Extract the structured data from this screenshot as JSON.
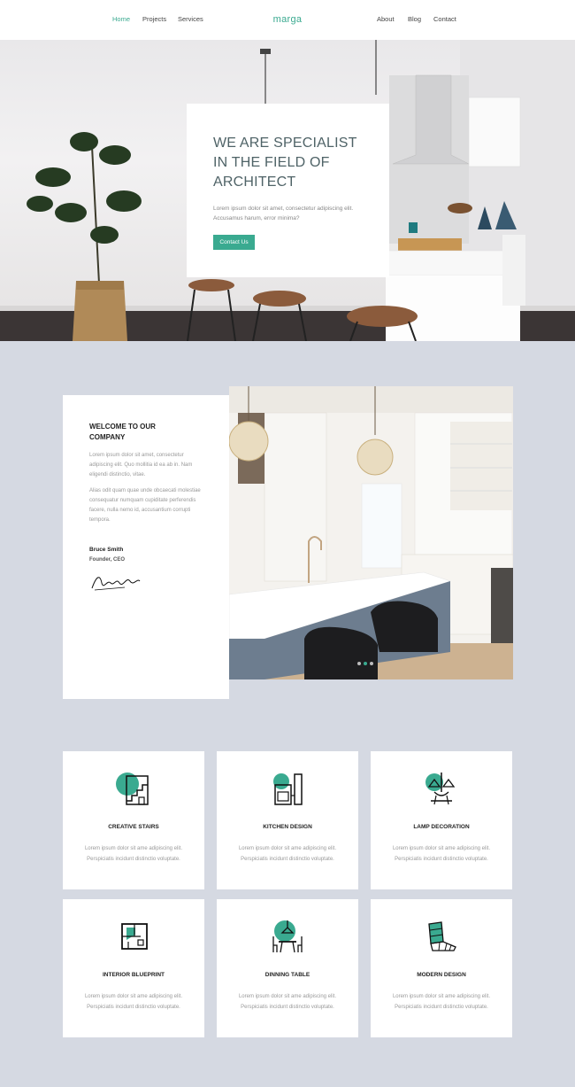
{
  "nav": {
    "left_links": [
      "Home",
      "Projects",
      "Services"
    ],
    "logo": "marga",
    "right_links": [
      "About",
      "Blog",
      "Contact"
    ],
    "active": "Home",
    "accent": "#3aaa90"
  },
  "hero": {
    "title": "WE ARE SPECIALIST IN THE FIELD OF ARCHITECT",
    "text": "Lorem ipsum dolor sit amet, consectetur adipiscing elit. Accusamus harum, error minima?",
    "button": "Contact Us"
  },
  "about": {
    "title": "WELCOME TO OUR COMPANY",
    "paragraph1": "Lorem ipsum dolor sit amet, consectetur adipiscing elit. Quo mollitia id ea ab in. Nam eligendi distinctio, vitae.",
    "paragraph2": "Alias odit quam quae unde obcaecati molestiae consequatur numquam cupiditate perferendis facere, nulla nemo id, accusantium corrupti tempora.",
    "name": "Bruce Smith",
    "role": "Founder, CEO",
    "slider_dots": 3,
    "active_dot": 1
  },
  "services": [
    {
      "title": "CREATIVE STAIRS",
      "text": "Lorem ipsum dolor sit ame adipiscing elit. Perspiciatis incidunt distinctio voluptate.",
      "icon": "stairs-icon"
    },
    {
      "title": "KITCHEN DESIGN",
      "text": "Lorem ipsum dolor sit ame adipiscing elit. Perspiciatis incidunt distinctio voluptate.",
      "icon": "kitchen-icon"
    },
    {
      "title": "LAMP DECORATION",
      "text": "Lorem ipsum dolor sit ame adipiscing elit. Perspiciatis incidunt distinctio voluptate.",
      "icon": "lamp-icon"
    },
    {
      "title": "INTERIOR BLUEPRINT",
      "text": "Lorem ipsum dolor sit ame adipiscing elit. Perspiciatis incidunt distinctio voluptate.",
      "icon": "blueprint-icon"
    },
    {
      "title": "DINNING TABLE",
      "text": "Lorem ipsum dolor sit ame adipiscing elit. Perspiciatis incidunt distinctio voluptate.",
      "icon": "dining-table-icon"
    },
    {
      "title": "MODERN DESIGN",
      "text": "Lorem ipsum dolor sit ame adipiscing elit. Perspiciatis incidunt distinctio voluptate.",
      "icon": "color-swatch-icon"
    }
  ],
  "colors": {
    "accent": "#3aaa90",
    "page_background": "#d5d9e2",
    "heading": "#4f6367"
  }
}
